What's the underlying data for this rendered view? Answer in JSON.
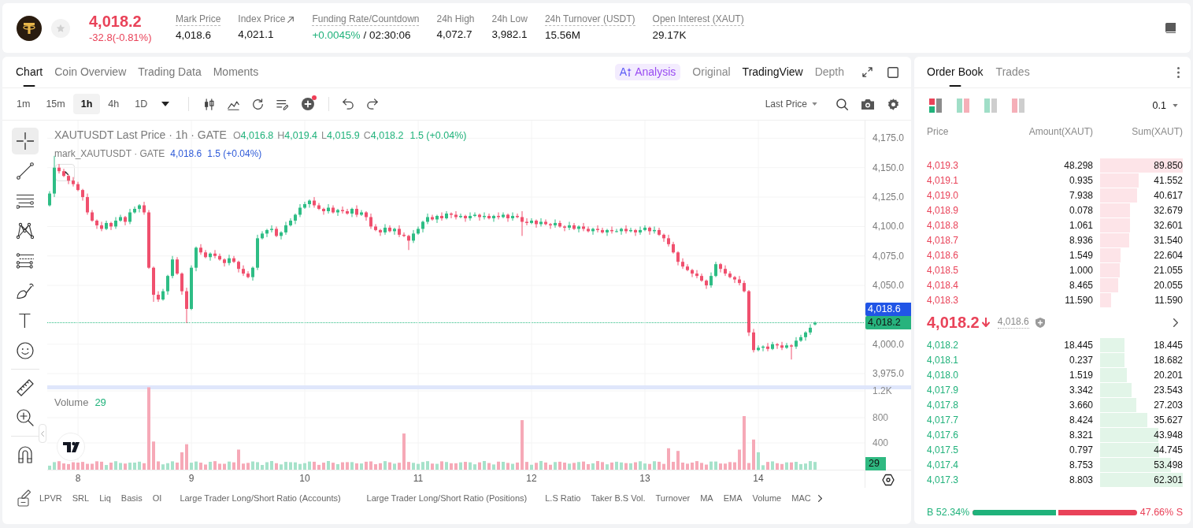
{
  "header": {
    "favorite": false,
    "price": "4,018.2",
    "rising": false,
    "change": "-32.8(-0.81%)",
    "stats": [
      {
        "label": "Mark Price",
        "value": "4,018.6",
        "underlined": true,
        "external": false,
        "positive": false
      },
      {
        "label": "Index Price",
        "value": "4,021.1",
        "underlined": false,
        "external": true,
        "positive": false
      },
      {
        "label": "Funding Rate/Countdown",
        "value": "+0.0045%",
        "countdown": "/ 02:30:06",
        "underlined": true,
        "external": false,
        "positive": true
      },
      {
        "label": "24h High",
        "value": "4,072.7",
        "underlined": false,
        "external": false,
        "positive": false
      },
      {
        "label": "24h Low",
        "value": "3,982.1",
        "underlined": false,
        "external": false,
        "positive": false
      },
      {
        "label": "24h Turnover (USDT)",
        "value": "15.56M",
        "underlined": true,
        "external": false,
        "positive": false
      },
      {
        "label": "Open Interest (XAUT)",
        "value": "29.17K",
        "underlined": true,
        "external": false,
        "positive": false
      }
    ]
  },
  "chart_panel": {
    "tabs": [
      {
        "label": "Chart",
        "selected": true
      },
      {
        "label": "Coin Overview",
        "selected": false
      },
      {
        "label": "Trading Data",
        "selected": false
      },
      {
        "label": "Moments",
        "selected": false
      }
    ],
    "analysis_button": {
      "mark": "A",
      "label": "Analysis"
    },
    "views": [
      {
        "label": "Original",
        "selected": false
      },
      {
        "label": "TradingView",
        "selected": true
      },
      {
        "label": "Depth",
        "selected": false
      }
    ],
    "intervals": [
      {
        "label": "1m",
        "selected": false
      },
      {
        "label": "15m",
        "selected": false
      },
      {
        "label": "1h",
        "selected": true
      },
      {
        "label": "4h",
        "selected": false
      },
      {
        "label": "1D",
        "selected": false
      }
    ],
    "price_source": "Last Price",
    "drawing_tools": [
      [
        {
          "kind": "crosshair",
          "selected": true
        },
        {
          "kind": "trend_line",
          "selected": false
        },
        {
          "kind": "parallel",
          "selected": false
        },
        {
          "kind": "pattern",
          "selected": false
        },
        {
          "kind": "fib",
          "selected": false
        },
        {
          "kind": "brush",
          "selected": false
        },
        {
          "kind": "text",
          "glyph": "T",
          "selected": false
        },
        {
          "kind": "emoji",
          "selected": false
        }
      ],
      [
        {
          "kind": "ruler",
          "selected": false
        },
        {
          "kind": "zoom",
          "selected": false
        }
      ],
      [
        {
          "kind": "magnet",
          "selected": false
        }
      ]
    ],
    "legend": {
      "title": "XAUTUSDT Last Price · 1h · GATE",
      "ohlc": [
        {
          "key": "O",
          "value": "4,016.8"
        },
        {
          "key": "H",
          "value": "4,019.4"
        },
        {
          "key": "L",
          "value": "4,015.9"
        },
        {
          "key": "C",
          "value": "4,018.2"
        }
      ],
      "change": "1.5 (+0.04%)",
      "mark_title": "mark_XAUTUSDT · GATE",
      "mark_value": "4,018.6",
      "mark_change": "1.5 (+0.04%)"
    },
    "chart_data": {
      "type": "candlestick",
      "grid": true,
      "ylim": [
        3878,
        4190
      ],
      "yticks": [
        {
          "value": 4175,
          "label": "4,175.0"
        },
        {
          "value": 4150,
          "label": "4,150.0"
        },
        {
          "value": 4125,
          "label": "4,125.0"
        },
        {
          "value": 4100,
          "label": "4,100.0"
        },
        {
          "value": 4075,
          "label": "4,075.0"
        },
        {
          "value": 4050,
          "label": "4,050.0"
        },
        {
          "value": 4000,
          "label": "4,000.0"
        },
        {
          "value": 3975,
          "label": "3,975.0"
        }
      ],
      "categories": [
        null,
        null,
        null,
        null,
        null,
        null,
        null,
        null,
        null,
        null,
        null,
        null,
        null,
        null,
        null,
        null,
        null,
        null,
        null,
        null,
        null,
        null,
        null,
        null,
        null,
        null,
        null,
        null,
        null,
        null,
        null,
        null,
        null,
        null,
        null,
        null,
        null,
        null,
        null,
        null,
        null,
        null,
        null,
        null,
        null,
        null,
        null,
        null,
        null,
        null,
        null,
        null,
        null,
        null,
        null,
        null,
        null,
        null,
        null,
        null,
        null,
        null,
        null,
        null,
        null,
        null,
        null,
        null,
        null,
        null,
        null,
        null,
        null,
        null,
        null,
        null,
        null,
        null,
        null,
        null,
        null,
        null,
        null,
        null,
        null,
        null,
        null,
        null,
        null,
        null,
        null,
        null,
        null,
        null,
        null,
        null,
        null,
        null,
        null,
        null,
        null,
        null,
        null,
        null,
        null,
        null,
        null,
        null,
        null,
        null,
        null,
        null,
        null,
        null,
        null,
        null,
        null,
        null,
        null,
        null,
        null,
        null,
        null,
        null,
        null,
        null,
        null,
        null,
        null,
        null,
        null,
        null,
        null,
        null,
        null,
        null,
        null,
        null,
        null,
        null,
        null,
        null,
        null,
        null,
        null,
        null,
        null,
        null,
        null,
        null,
        null,
        null,
        null,
        null,
        null,
        null,
        null,
        null,
        null,
        null,
        null,
        null,
        null,
        null,
        null,
        null,
        null,
        null,
        null,
        null,
        null,
        null,
        null
      ],
      "ohlc": [
        [
          4118,
          4130,
          4117,
          4128
        ],
        [
          4128,
          4160,
          4125,
          4150
        ],
        [
          4150,
          4153,
          4145,
          4147
        ],
        [
          4147,
          4149,
          4142,
          4143
        ],
        [
          4143,
          4144,
          4136,
          4139
        ],
        [
          4139,
          4142,
          4134,
          4136
        ],
        [
          4136,
          4138,
          4130,
          4131
        ],
        [
          4131,
          4132,
          4122,
          4125
        ],
        [
          4125,
          4128,
          4110,
          4112
        ],
        [
          4112,
          4114,
          4104,
          4105
        ],
        [
          4105,
          4106,
          4098,
          4101
        ],
        [
          4101,
          4104,
          4096,
          4098
        ],
        [
          4098,
          4105,
          4097,
          4103
        ],
        [
          4103,
          4104,
          4097,
          4100
        ],
        [
          4100,
          4108,
          4098,
          4105
        ],
        [
          4105,
          4110,
          4104,
          4108
        ],
        [
          4108,
          4109,
          4101,
          4104
        ],
        [
          4104,
          4115,
          4102,
          4112
        ],
        [
          4112,
          4117,
          4111,
          4115
        ],
        [
          4115,
          4119,
          4112,
          4118
        ],
        [
          4118,
          4121,
          4110,
          4112
        ],
        [
          4112,
          4114,
          4064,
          4065
        ],
        [
          4065,
          4066,
          4036,
          4042
        ],
        [
          4042,
          4045,
          4036,
          4038
        ],
        [
          4038,
          4047,
          4037,
          4045
        ],
        [
          4045,
          4059,
          4042,
          4058
        ],
        [
          4058,
          4075,
          4056,
          4072
        ],
        [
          4072,
          4074,
          4059,
          4060
        ],
        [
          4060,
          4061,
          4042,
          4045
        ],
        [
          4045,
          4048,
          4018,
          4030
        ],
        [
          4030,
          4067,
          4029,
          4065
        ],
        [
          4065,
          4083,
          4062,
          4082
        ],
        [
          4082,
          4085,
          4076,
          4078
        ],
        [
          4078,
          4080,
          4073,
          4074
        ],
        [
          4074,
          4078,
          4071,
          4077
        ],
        [
          4077,
          4080,
          4073,
          4075
        ],
        [
          4075,
          4077,
          4071,
          4072
        ],
        [
          4072,
          4073,
          4066,
          4069
        ],
        [
          4069,
          4076,
          4067,
          4073
        ],
        [
          4073,
          4075,
          4069,
          4070
        ],
        [
          4070,
          4071,
          4061,
          4064
        ],
        [
          4064,
          4067,
          4058,
          4060
        ],
        [
          4060,
          4062,
          4056,
          4057
        ],
        [
          4057,
          4066,
          4054,
          4065
        ],
        [
          4065,
          4093,
          4063,
          4090
        ],
        [
          4090,
          4096,
          4089,
          4094
        ],
        [
          4094,
          4098,
          4091,
          4097
        ],
        [
          4097,
          4101,
          4095,
          4098
        ],
        [
          4098,
          4100,
          4091,
          4092
        ],
        [
          4092,
          4096,
          4089,
          4095
        ],
        [
          4095,
          4104,
          4093,
          4101
        ],
        [
          4101,
          4107,
          4100,
          4105
        ],
        [
          4105,
          4111,
          4102,
          4110
        ],
        [
          4110,
          4119,
          4108,
          4116
        ],
        [
          4116,
          4121,
          4115,
          4119
        ],
        [
          4119,
          4123,
          4116,
          4122
        ],
        [
          4122,
          4125,
          4116,
          4118
        ],
        [
          4118,
          4120,
          4114,
          4115
        ],
        [
          4115,
          4116,
          4110,
          4113
        ],
        [
          4113,
          4119,
          4111,
          4116
        ],
        [
          4116,
          4118,
          4111,
          4112
        ],
        [
          4112,
          4115,
          4109,
          4114
        ],
        [
          4114,
          4117,
          4111,
          4113
        ],
        [
          4113,
          4115,
          4110,
          4111
        ],
        [
          4111,
          4116,
          4108,
          4115
        ],
        [
          4115,
          4118,
          4108,
          4110
        ],
        [
          4110,
          4114,
          4109,
          4112
        ],
        [
          4112,
          4113,
          4105,
          4108
        ],
        [
          4108,
          4111,
          4098,
          4100
        ],
        [
          4100,
          4102,
          4096,
          4097
        ],
        [
          4097,
          4098,
          4092,
          4095
        ],
        [
          4095,
          4102,
          4093,
          4099
        ],
        [
          4099,
          4101,
          4095,
          4096
        ],
        [
          4096,
          4099,
          4093,
          4098
        ],
        [
          4098,
          4101,
          4091,
          4093
        ],
        [
          4093,
          4095,
          4091,
          4092
        ],
        [
          4092,
          4093,
          4080,
          4088
        ],
        [
          4088,
          4097,
          4086,
          4094
        ],
        [
          4094,
          4100,
          4093,
          4098
        ],
        [
          4098,
          4105,
          4095,
          4104
        ],
        [
          4104,
          4111,
          4102,
          4108
        ],
        [
          4108,
          4110,
          4105,
          4106
        ],
        [
          4106,
          4110,
          4103,
          4109
        ],
        [
          4109,
          4112,
          4105,
          4107
        ],
        [
          4107,
          4113,
          4106,
          4111
        ],
        [
          4111,
          4112,
          4107,
          4110
        ],
        [
          4110,
          4113,
          4106,
          4108
        ],
        [
          4108,
          4111,
          4107,
          4109
        ],
        [
          4109,
          4110,
          4104,
          4107
        ],
        [
          4107,
          4112,
          4105,
          4109
        ],
        [
          4109,
          4112,
          4108,
          4110
        ],
        [
          4110,
          4111,
          4105,
          4108
        ],
        [
          4108,
          4112,
          4106,
          4109
        ],
        [
          4109,
          4111,
          4106,
          4107
        ],
        [
          4107,
          4110,
          4104,
          4109
        ],
        [
          4109,
          4112,
          4106,
          4108
        ],
        [
          4108,
          4112,
          4107,
          4110
        ],
        [
          4110,
          4111,
          4104,
          4107
        ],
        [
          4107,
          4112,
          4105,
          4109
        ],
        [
          4109,
          4111,
          4107,
          4108
        ],
        [
          4108,
          4113,
          4092,
          4104
        ],
        [
          4104,
          4107,
          4101,
          4103
        ],
        [
          4103,
          4107,
          4102,
          4105
        ],
        [
          4105,
          4106,
          4099,
          4102
        ],
        [
          4102,
          4107,
          4100,
          4104
        ],
        [
          4104,
          4106,
          4101,
          4102
        ],
        [
          4102,
          4103,
          4098,
          4101
        ],
        [
          4101,
          4106,
          4099,
          4103
        ],
        [
          4103,
          4105,
          4099,
          4100
        ],
        [
          4100,
          4101,
          4096,
          4099
        ],
        [
          4099,
          4104,
          4097,
          4101
        ],
        [
          4101,
          4103,
          4097,
          4098
        ],
        [
          4098,
          4101,
          4095,
          4100
        ],
        [
          4100,
          4103,
          4096,
          4098
        ],
        [
          4098,
          4100,
          4095,
          4096
        ],
        [
          4096,
          4099,
          4093,
          4098
        ],
        [
          4098,
          4101,
          4095,
          4097
        ],
        [
          4097,
          4099,
          4094,
          4095
        ],
        [
          4095,
          4098,
          4092,
          4097
        ],
        [
          4097,
          4100,
          4094,
          4096
        ],
        [
          4096,
          4098,
          4095,
          4096
        ],
        [
          4096,
          4099,
          4093,
          4098
        ],
        [
          4098,
          4101,
          4094,
          4096
        ],
        [
          4096,
          4099,
          4095,
          4097
        ],
        [
          4097,
          4098,
          4092,
          4095
        ],
        [
          4095,
          4100,
          4093,
          4097
        ],
        [
          4097,
          4101,
          4096,
          4099
        ],
        [
          4099,
          4100,
          4093,
          4096
        ],
        [
          4096,
          4100,
          4094,
          4097
        ],
        [
          4097,
          4099,
          4092,
          4093
        ],
        [
          4093,
          4094,
          4087,
          4090
        ],
        [
          4090,
          4093,
          4083,
          4085
        ],
        [
          4085,
          4087,
          4077,
          4078
        ],
        [
          4078,
          4079,
          4067,
          4070
        ],
        [
          4070,
          4073,
          4064,
          4066
        ],
        [
          4066,
          4068,
          4062,
          4063
        ],
        [
          4063,
          4064,
          4057,
          4060
        ],
        [
          4060,
          4063,
          4056,
          4058
        ],
        [
          4058,
          4060,
          4053,
          4054
        ],
        [
          4054,
          4055,
          4047,
          4050
        ],
        [
          4050,
          4061,
          4048,
          4058
        ],
        [
          4058,
          4070,
          4057,
          4068
        ],
        [
          4068,
          4069,
          4061,
          4064
        ],
        [
          4064,
          4067,
          4058,
          4060
        ],
        [
          4060,
          4062,
          4056,
          4057
        ],
        [
          4057,
          4058,
          4052,
          4055
        ],
        [
          4055,
          4058,
          4050,
          4052
        ],
        [
          4052,
          4054,
          4044,
          4045
        ],
        [
          4045,
          4046,
          4007,
          4010
        ],
        [
          4010,
          4013,
          3993,
          3995
        ],
        [
          3995,
          3999,
          3994,
          3997
        ],
        [
          3997,
          3999,
          3994,
          3998
        ],
        [
          3998,
          4001,
          3994,
          3996
        ],
        [
          3996,
          4002,
          3995,
          4000
        ],
        [
          4000,
          4001,
          3996,
          3999
        ],
        [
          3999,
          4002,
          3995,
          3997
        ],
        [
          3997,
          4001,
          3996,
          3999
        ],
        [
          3999,
          4000,
          3987,
          3998
        ],
        [
          3998,
          4006,
          3996,
          4003
        ],
        [
          4003,
          4008,
          4002,
          4006
        ],
        [
          4006,
          4011,
          4003,
          4010
        ],
        [
          4010,
          4017,
          4008,
          4014
        ],
        [
          4016.8,
          4019.4,
          4015.9,
          4018.2
        ],
        null,
        null,
        null,
        null,
        null,
        null,
        null,
        null,
        null,
        null
      ]
    },
    "price_tags": [
      {
        "kind": "mark",
        "value": "4,018.6"
      },
      {
        "kind": "last",
        "value": "4,018.2"
      }
    ],
    "volume": {
      "label": "Volume",
      "value": "29",
      "axis": [
        "1.2K",
        "800",
        "400"
      ],
      "tag": "29"
    },
    "time_axis": [
      "8",
      "9",
      "10",
      "11",
      "12",
      "13",
      "14"
    ],
    "indicators": [
      "LPVR",
      "SRL",
      "Liq",
      "Basis",
      "OI",
      "Large Trader Long/Short Ratio (Accounts)",
      "Large Trader Long/Short Ratio (Positions)",
      "L.S Ratio",
      "Taker B.S Vol.",
      "Turnover",
      "MA",
      "EMA",
      "Volume",
      "MAC"
    ]
  },
  "order_book": {
    "tabs": [
      {
        "label": "Order Book",
        "selected": true
      },
      {
        "label": "Trades",
        "selected": false
      }
    ],
    "layouts": [
      {
        "kind": "both",
        "selected": true
      },
      {
        "kind": "split",
        "selected": false
      },
      {
        "kind": "bids",
        "selected": false
      },
      {
        "kind": "asks",
        "selected": false
      }
    ],
    "precision": "0.1",
    "columns": [
      "Price",
      "Amount(XAUT)",
      "Sum(XAUT)"
    ],
    "asks": [
      {
        "price": "4,019.3",
        "amount": "48.298",
        "sum": "89.850"
      },
      {
        "price": "4,019.1",
        "amount": "0.935",
        "sum": "41.552"
      },
      {
        "price": "4,019.0",
        "amount": "7.938",
        "sum": "40.617"
      },
      {
        "price": "4,018.9",
        "amount": "0.078",
        "sum": "32.679"
      },
      {
        "price": "4,018.8",
        "amount": "1.061",
        "sum": "32.601"
      },
      {
        "price": "4,018.7",
        "amount": "8.936",
        "sum": "31.540"
      },
      {
        "price": "4,018.6",
        "amount": "1.549",
        "sum": "22.604"
      },
      {
        "price": "4,018.5",
        "amount": "1.000",
        "sum": "21.055"
      },
      {
        "price": "4,018.4",
        "amount": "8.465",
        "sum": "20.055"
      },
      {
        "price": "4,018.3",
        "amount": "11.590",
        "sum": "11.590"
      }
    ],
    "last_price": {
      "value": "4,018.2",
      "rising": false,
      "mark": "4,018.6"
    },
    "bids": [
      {
        "price": "4,018.2",
        "amount": "18.445",
        "sum": "18.445"
      },
      {
        "price": "4,018.1",
        "amount": "0.237",
        "sum": "18.682"
      },
      {
        "price": "4,018.0",
        "amount": "1.519",
        "sum": "20.201"
      },
      {
        "price": "4,017.9",
        "amount": "3.342",
        "sum": "23.543"
      },
      {
        "price": "4,017.8",
        "amount": "3.660",
        "sum": "27.203"
      },
      {
        "price": "4,017.7",
        "amount": "8.424",
        "sum": "35.627"
      },
      {
        "price": "4,017.6",
        "amount": "8.321",
        "sum": "43.948"
      },
      {
        "price": "4,017.5",
        "amount": "0.797",
        "sum": "44.745"
      },
      {
        "price": "4,017.4",
        "amount": "8.753",
        "sum": "53.498"
      },
      {
        "price": "4,017.3",
        "amount": "8.803",
        "sum": "62.301"
      }
    ],
    "ratio": {
      "buy": "B 52.34%",
      "sell": "47.66% S",
      "level": 0.5234
    }
  }
}
